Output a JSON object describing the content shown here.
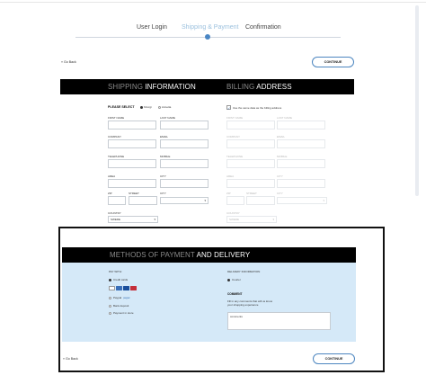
{
  "steps": [
    {
      "label": "User Login"
    },
    {
      "label": "Shipping & Payment"
    },
    {
      "label": "Confirmation"
    }
  ],
  "nav": {
    "back_label": "« Go Back",
    "continue_label": "CONTINUE"
  },
  "shipping": {
    "title_thin": "SHIPPING",
    "title_bold": "INFORMATION",
    "please_select": "PLEASE SELECT",
    "option_1": "Kirurgi",
    "option_2": "Annetta",
    "first_name_label": "FIRST NAME",
    "last_name_label": "LAST NAME",
    "company_label": "COMPANY",
    "email_label": "EMAIL",
    "telephone_label": "TELEPHONE",
    "mobile_label": "MOBILE",
    "area_label": "AREA",
    "city_label": "CITY",
    "zip_label": "ZIP",
    "street_label": "STREET",
    "city2_label": "CITY",
    "country_label": "COUNTRY",
    "country_value": "SWEDE"
  },
  "billing": {
    "title_thin": "BILLING",
    "title_bold": "ADDRESS",
    "same_as_label": "Use the same data as the billing address",
    "first_name_label": "FIRST NAME",
    "last_name_label": "LAST NAME",
    "company_label": "COMPANY",
    "email_label": "EMAIL",
    "telephone_label": "TELEPHONE",
    "mobile_label": "MOBILE",
    "area_label": "AREA",
    "city_label": "CITY",
    "zip_label": "ZIP",
    "street_label": "STREET",
    "city2_label": "CITY",
    "country_label": "COUNTRY",
    "country_value": "SWEDE"
  },
  "payment": {
    "title_thin": "METHODS OF PAYMENT",
    "title_bold": "AND DELIVERY",
    "pay_with_label": "PAY WITH:",
    "credit_cards_label": "Credit cards",
    "paypal_label": "Paypal",
    "paypal_sub": "paypal",
    "bank_deposit_label": "Bank deposit",
    "payment_in_store_label": "Payment in store",
    "delivery_label": "DELIVERY INFORMATION",
    "courier_label": "Courier",
    "comment_label": "COMMENT",
    "comment_help_1": "Fill in any comments that will us know",
    "comment_help_2": "your shopping experience",
    "comment_value": "comments"
  },
  "colors": {
    "accent_blue": "#4a86c4",
    "step_active": "#9cc1de",
    "panel_blue": "#d5e9f8"
  }
}
